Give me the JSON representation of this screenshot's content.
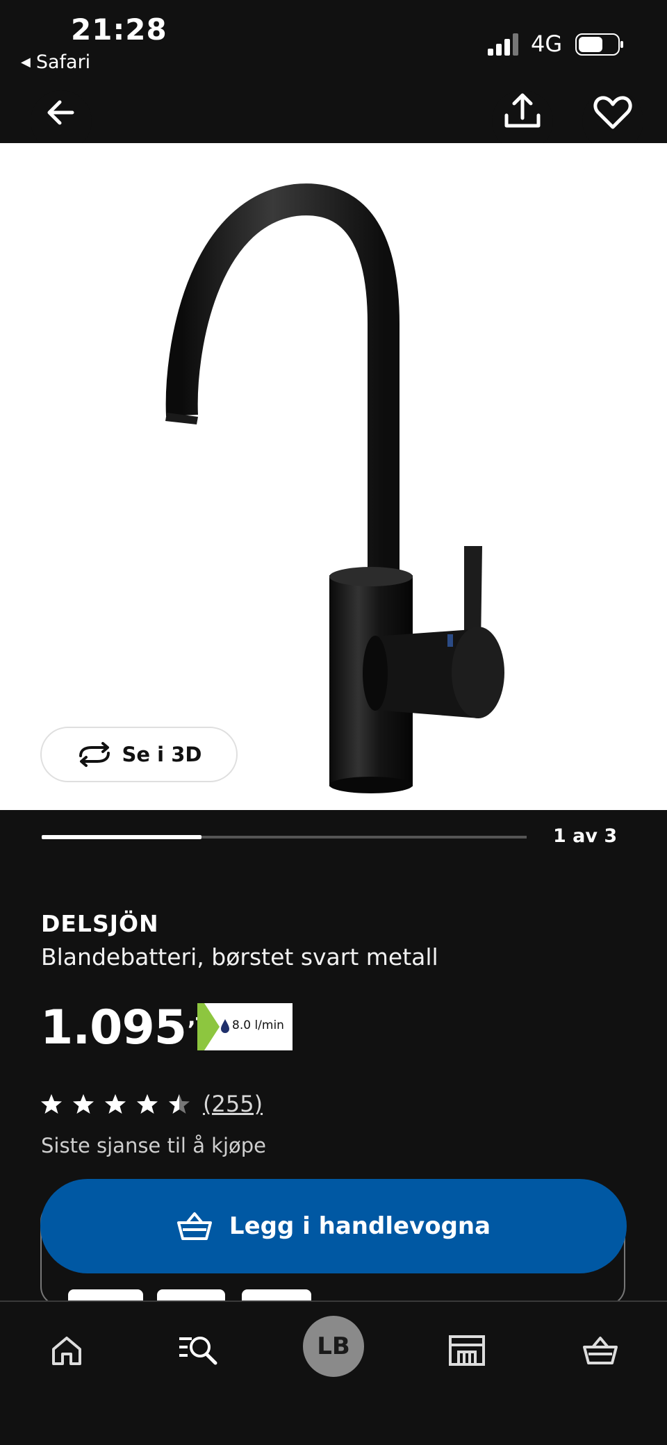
{
  "status_bar": {
    "time": "21:28",
    "back_app": "Safari",
    "network": "4G"
  },
  "header": {
    "back_icon": "arrow-left-icon",
    "share_icon": "share-icon",
    "favorite_icon": "heart-icon"
  },
  "gallery": {
    "view_3d_label": "Se i 3D",
    "counter": "1 av 3",
    "progress": 0.33
  },
  "product": {
    "name": "DELSJÖN",
    "description": "Blandebatteri, børstet svart metall",
    "price": "1.095",
    "price_suffix": ",-",
    "flow_rate": "8.0 l/min",
    "rating": 4.5,
    "review_count": "(255)",
    "availability": "Siste sjanse til å kjøpe"
  },
  "cart": {
    "add_label": "Legg i handlevogna"
  },
  "bottom_nav": {
    "avatar_initials": "LB",
    "items": [
      "home-icon",
      "search-icon",
      "avatar",
      "store-icon",
      "basket-icon"
    ]
  },
  "colors": {
    "background": "#111111",
    "cart_button": "#0058a3",
    "energy_green": "#8dc63f"
  }
}
